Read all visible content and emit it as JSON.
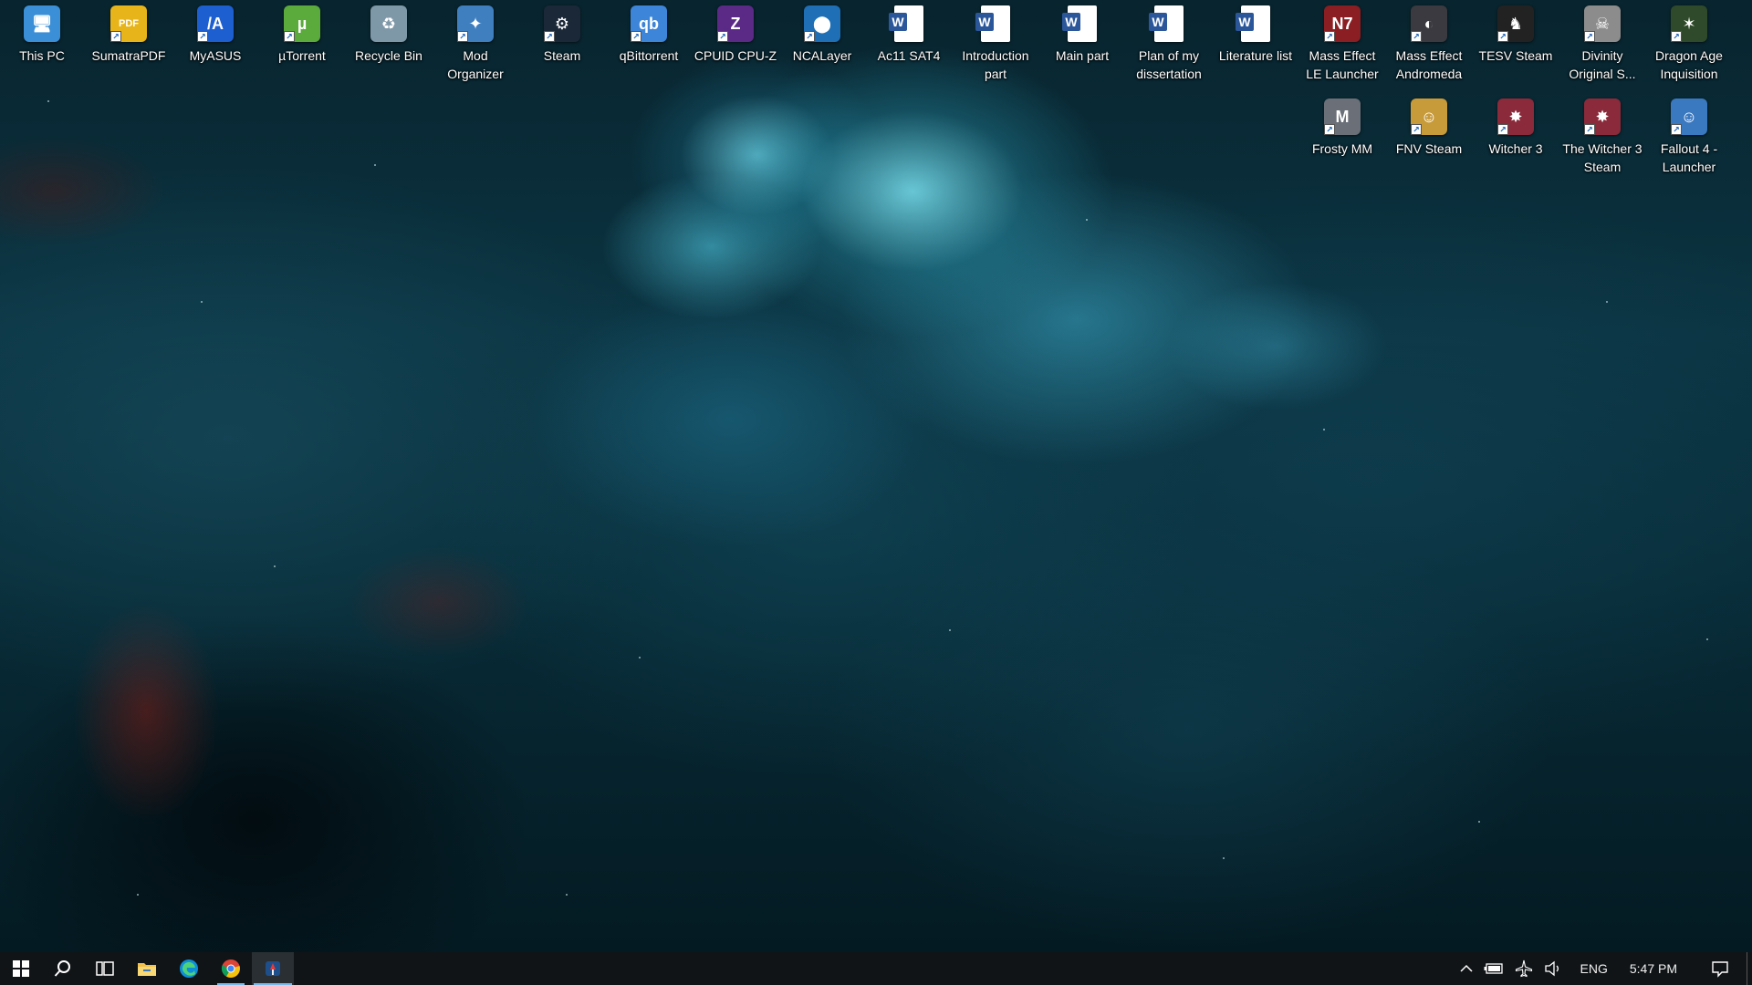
{
  "desktop": {
    "icons_row1": [
      {
        "name": "this-pc-icon",
        "label": "This PC",
        "glyph": "🖥",
        "color": "#3a8fd6",
        "shortcut": false
      },
      {
        "name": "sumatrapdf-icon",
        "label": "SumatraPDF",
        "glyph": "PDF",
        "color": "#e7b51a",
        "shortcut": true
      },
      {
        "name": "myasus-icon",
        "label": "MyASUS",
        "glyph": "/A",
        "color": "#1d5fd0",
        "shortcut": true
      },
      {
        "name": "utorrent-icon",
        "label": "µTorrent",
        "glyph": "µ",
        "color": "#5aaa3c",
        "shortcut": true
      },
      {
        "name": "recycle-bin-icon",
        "label": "Recycle Bin",
        "glyph": "♻",
        "color": "#7f98a8",
        "shortcut": false
      },
      {
        "name": "mod-organizer-icon",
        "label": "Mod Organizer",
        "glyph": "✦",
        "color": "#3f7fc0",
        "shortcut": true
      },
      {
        "name": "steam-icon",
        "label": "Steam",
        "glyph": "⚙",
        "color": "#1b2838",
        "shortcut": true
      },
      {
        "name": "qbittorrent-icon",
        "label": "qBittorrent",
        "glyph": "qb",
        "color": "#3d85d8",
        "shortcut": true
      },
      {
        "name": "cpuid-cpuz-icon",
        "label": "CPUID CPU-Z",
        "glyph": "Z",
        "color": "#5b2a86",
        "shortcut": true
      },
      {
        "name": "ncalayer-icon",
        "label": "NCALayer",
        "glyph": "⬤",
        "color": "#1e6fb5",
        "shortcut": true
      },
      {
        "name": "word-doc-icon",
        "label": "Ac11 SAT4",
        "glyph": "W",
        "color": "#2b579a",
        "shortcut": false,
        "word": true
      },
      {
        "name": "word-doc-icon",
        "label": "Introduction part",
        "glyph": "W",
        "color": "#2b579a",
        "shortcut": false,
        "word": true
      },
      {
        "name": "word-doc-icon",
        "label": "Main part",
        "glyph": "W",
        "color": "#2b579a",
        "shortcut": false,
        "word": true
      },
      {
        "name": "word-doc-icon",
        "label": "Plan of my dissertation",
        "glyph": "W",
        "color": "#2b579a",
        "shortcut": false,
        "word": true
      },
      {
        "name": "word-doc-icon",
        "label": "Literature list",
        "glyph": "W",
        "color": "#2b579a",
        "shortcut": false,
        "word": true
      },
      {
        "name": "mass-effect-le-icon",
        "label": "Mass Effect LE Launcher",
        "glyph": "N7",
        "color": "#8a1e22",
        "shortcut": true
      },
      {
        "name": "mass-effect-andromeda-icon",
        "label": "Mass Effect Andromeda",
        "glyph": "◐",
        "color": "#3a3a40",
        "shortcut": true
      },
      {
        "name": "tesv-icon",
        "label": "TESV Steam",
        "glyph": "♞",
        "color": "#222222",
        "shortcut": true
      },
      {
        "name": "divinity-icon",
        "label": "Divinity Original S...",
        "glyph": "☠",
        "color": "#8c8c8c",
        "shortcut": true
      },
      {
        "name": "dragon-age-icon",
        "label": "Dragon Age Inquisition",
        "glyph": "✶",
        "color": "#2f4a2a",
        "shortcut": true
      }
    ],
    "icons_row2": [
      {
        "name": "frosty-mm-icon",
        "label": "Frosty MM",
        "glyph": "M",
        "color": "#6a6f78",
        "shortcut": true
      },
      {
        "name": "fnv-icon",
        "label": "FNV Steam",
        "glyph": "☺",
        "color": "#c79a3a",
        "shortcut": true
      },
      {
        "name": "witcher-3-icon",
        "label": "Witcher 3",
        "glyph": "✸",
        "color": "#8a2a3a",
        "shortcut": true
      },
      {
        "name": "witcher-3-steam-icon",
        "label": "The Witcher 3 Steam",
        "glyph": "✸",
        "color": "#8a2a3a",
        "shortcut": true
      },
      {
        "name": "fallout-4-icon",
        "label": "Fallout 4 - Launcher",
        "glyph": "☺",
        "color": "#3a78c0",
        "shortcut": true
      }
    ]
  },
  "taskbar": {
    "start_icon": "windows-start-icon",
    "apps": [
      {
        "name": "search-icon",
        "glyph": "⚲"
      },
      {
        "name": "task-view-icon",
        "glyph": "⊞"
      },
      {
        "name": "file-explorer-icon",
        "glyph": "📁"
      },
      {
        "name": "edge-icon",
        "glyph": "e"
      },
      {
        "name": "chrome-icon",
        "glyph": "◉"
      },
      {
        "name": "running-app-icon",
        "glyph": "⚑"
      }
    ],
    "tray": {
      "chevron": "^",
      "lang": "ENG",
      "time": "5:47 PM"
    }
  }
}
